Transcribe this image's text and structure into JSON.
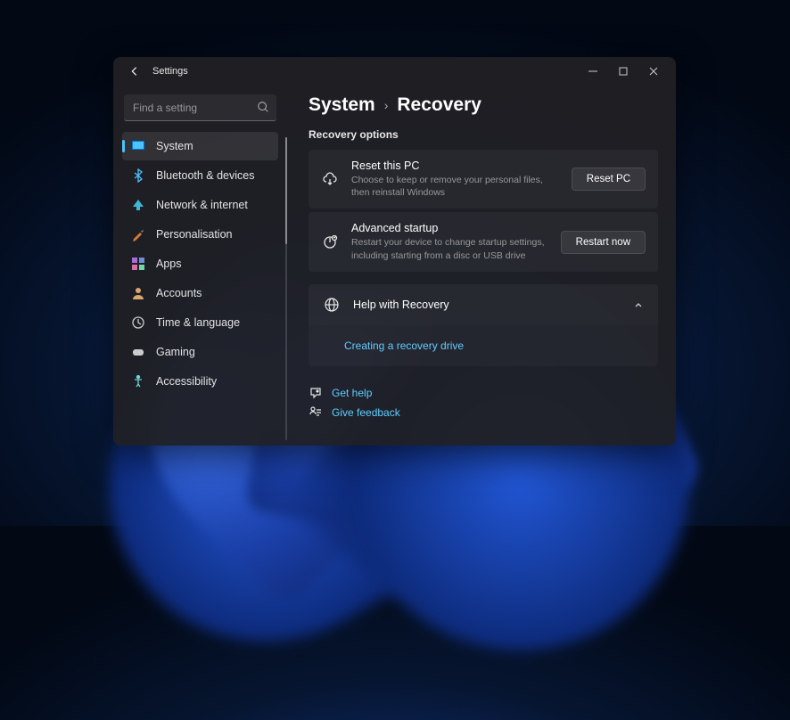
{
  "header": {
    "app_title": "Settings"
  },
  "search": {
    "placeholder": "Find a setting"
  },
  "sidebar": {
    "items": [
      {
        "label": "System",
        "icon": "display",
        "active": true
      },
      {
        "label": "Bluetooth & devices",
        "icon": "bluetooth",
        "active": false
      },
      {
        "label": "Network & internet",
        "icon": "wifi",
        "active": false
      },
      {
        "label": "Personalisation",
        "icon": "brush",
        "active": false
      },
      {
        "label": "Apps",
        "icon": "apps",
        "active": false
      },
      {
        "label": "Accounts",
        "icon": "person",
        "active": false
      },
      {
        "label": "Time & language",
        "icon": "clock",
        "active": false
      },
      {
        "label": "Gaming",
        "icon": "gaming",
        "active": false
      },
      {
        "label": "Accessibility",
        "icon": "accessibility",
        "active": false
      }
    ]
  },
  "breadcrumb": {
    "root": "System",
    "page": "Recovery"
  },
  "main": {
    "section_label": "Recovery options",
    "cards": [
      {
        "title": "Reset this PC",
        "desc": "Choose to keep or remove your personal files, then reinstall Windows",
        "button": "Reset PC"
      },
      {
        "title": "Advanced startup",
        "desc": "Restart your device to change startup settings, including starting from a disc or USB drive",
        "button": "Restart now"
      }
    ],
    "expander": {
      "title": "Help with Recovery",
      "link": "Creating a recovery drive"
    },
    "footer": {
      "help": "Get help",
      "feedback": "Give feedback"
    }
  },
  "colors": {
    "accent": "#4cc2ff",
    "link": "#60cdff"
  }
}
